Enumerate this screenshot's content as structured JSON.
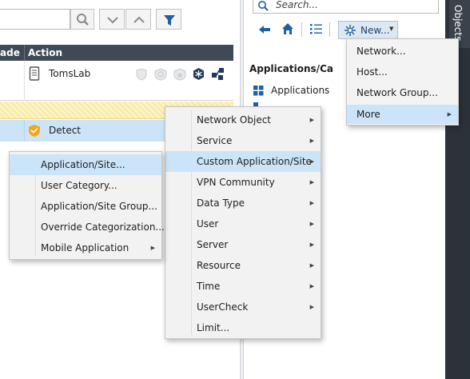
{
  "toolbar": {
    "search_icon": "magnifier-icon",
    "collapse_icon": "chevron-down-icon",
    "expand_icon": "chevron-up-icon",
    "filter_icon": "filter-icon"
  },
  "grid": {
    "headers": {
      "partial": "ade",
      "action": "Action"
    },
    "rows": [
      {
        "name": "TomsLab",
        "icon": "gateway-icon"
      },
      {
        "name": "Detect",
        "icon": "shield-detect-icon"
      }
    ],
    "blade_icons": [
      "shield-icon",
      "badge-icon",
      "shield-star-icon",
      "snowflake-icon",
      "network-icon"
    ]
  },
  "objects_panel": {
    "search_placeholder": "Search...",
    "new_button": "New...",
    "section_title": "Applications/Ca",
    "first_item": "Applications",
    "side_tab": "Objects"
  },
  "new_menu": {
    "items": [
      "Network...",
      "Host...",
      "Network Group..."
    ],
    "more": "More"
  },
  "more_menu": {
    "items": [
      "Network Object",
      "Service",
      "Custom Application/Site",
      "VPN Community",
      "Data Type",
      "User",
      "Server",
      "Resource",
      "Time",
      "UserCheck",
      "Limit..."
    ]
  },
  "custom_app_menu": {
    "items": [
      "Application/Site...",
      "User Category...",
      "Application/Site Group...",
      "Override Categorization...",
      "Mobile Application"
    ]
  },
  "colors": {
    "accent": "#0a74c4",
    "highlight": "#cce4f7",
    "header_bg": "#404a54",
    "dark_bar": "#2b323a"
  }
}
